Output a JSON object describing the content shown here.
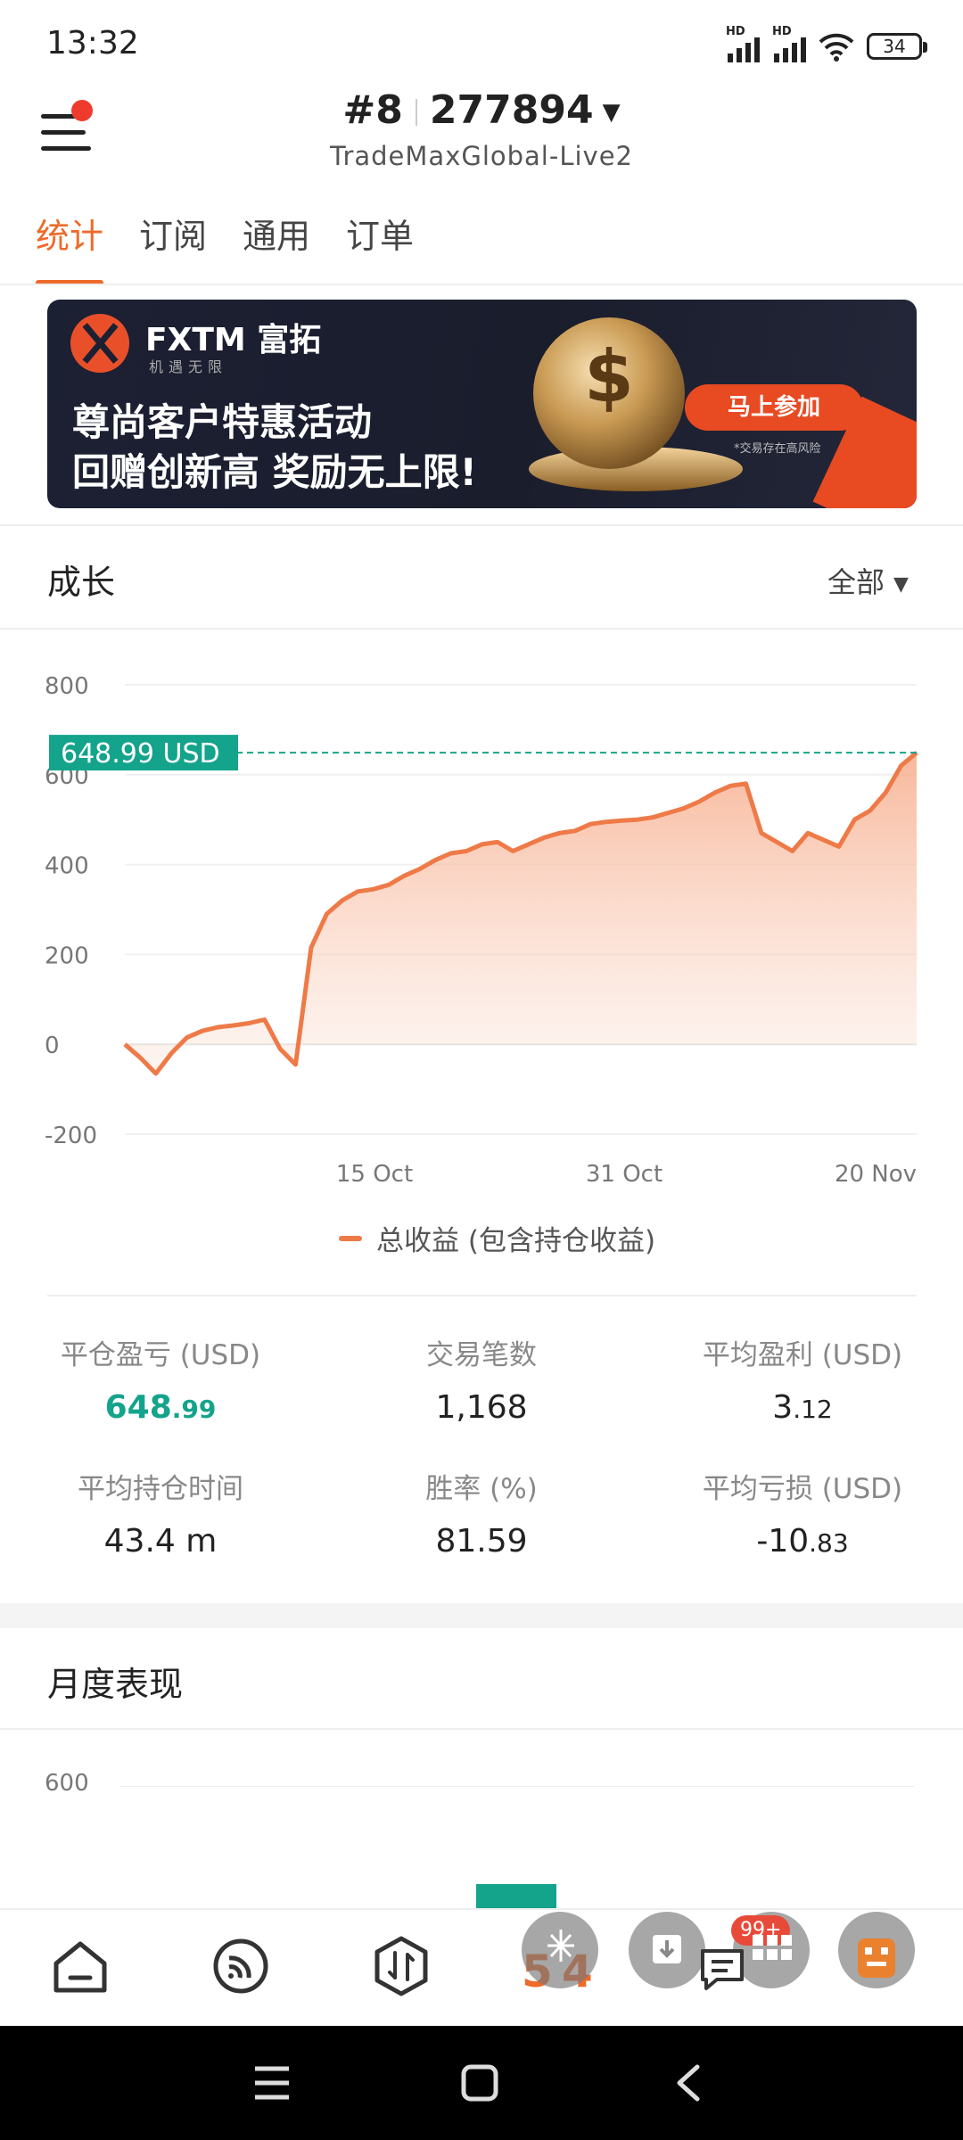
{
  "status_bar": {
    "time": "13:32",
    "signal_label_1": "HD",
    "signal_label_2": "HD",
    "battery": "34",
    "icons": [
      "signal-icon",
      "signal-icon",
      "wifi-icon",
      "battery-icon"
    ]
  },
  "header": {
    "account_prefix": "#8",
    "account_number": "277894",
    "server": "TradeMaxGlobal-Live2"
  },
  "tabs": [
    "统计",
    "订阅",
    "通用",
    "订单"
  ],
  "banner": {
    "brand": "FXTM 富拓",
    "brand_sub": "机遇无限",
    "line1": "尊尚客户特惠活动",
    "line2": "回赠创新高 奖励无上限!",
    "cta": "马上参加",
    "risk": "*交易存在高风险",
    "coin_symbol": "$"
  },
  "growth": {
    "title": "成长",
    "filter": "全部"
  },
  "chart_data": {
    "type": "area",
    "x_ticks": [
      "15 Oct",
      "31 Oct",
      "20 Nov"
    ],
    "y_ticks": [
      "800",
      "600",
      "400",
      "200",
      "0",
      "-200"
    ],
    "ylim": [
      -200,
      800
    ],
    "current_label": "648.99 USD",
    "current_value": 648.99,
    "series": [
      {
        "name": "总收益 (包含持仓收益)",
        "color": "#ee7a48",
        "values": [
          0,
          -30,
          -65,
          -20,
          15,
          30,
          38,
          42,
          47,
          55,
          -10,
          -45,
          215,
          290,
          320,
          340,
          345,
          355,
          375,
          390,
          410,
          425,
          430,
          445,
          450,
          430,
          445,
          460,
          470,
          475,
          490,
          495,
          498,
          500,
          505,
          515,
          525,
          540,
          560,
          575,
          580,
          470,
          450,
          430,
          470,
          455,
          440,
          500,
          520,
          560,
          620,
          648.99
        ]
      }
    ]
  },
  "stats": [
    {
      "label": "平仓盈亏 (USD)",
      "value_main": "648",
      "value_dec": ".99",
      "green": true
    },
    {
      "label": "交易笔数",
      "value_main": "1,168",
      "value_dec": "",
      "green": false
    },
    {
      "label": "平均盈利 (USD)",
      "value_main": "3",
      "value_dec": ".12",
      "green": false
    },
    {
      "label": "平均持仓时间",
      "value_main": "43.4 m",
      "value_dec": "",
      "green": false
    },
    {
      "label": "胜率 (%)",
      "value_main": "81.59",
      "value_dec": "",
      "green": false
    },
    {
      "label": "平均亏损 (USD)",
      "value_main": "-10",
      "value_dec": ".83",
      "green": false
    }
  ],
  "monthly": {
    "title": "月度表现",
    "tick": "600"
  },
  "bottom_nav": {
    "items": [
      "home-icon",
      "signals-icon",
      "trade-icon",
      "flash-icon"
    ],
    "badge": "99+",
    "accent": "#ee6a2a",
    "green": "#14a38b"
  }
}
